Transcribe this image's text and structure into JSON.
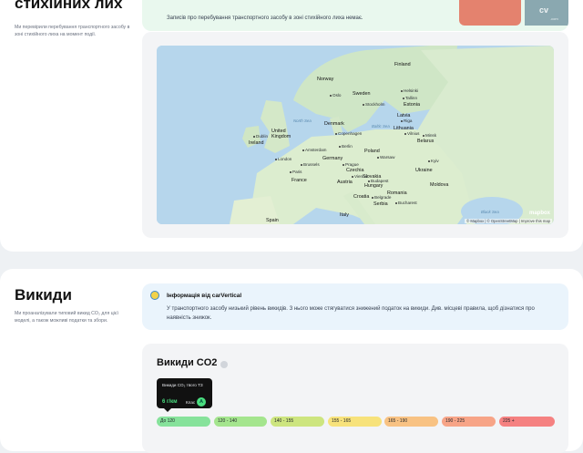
{
  "disasters": {
    "title": "стихійних лих",
    "description": "Ми перевірили перебування транспортного засобу в зоні стихійного лиха на момент події.",
    "notice": "Записів про перебування транспортного засобу в зоні стихійного лиха немає.",
    "thumbnail_logo": "cv",
    "thumbnail_small": ".com",
    "map": {
      "attribution": "© Mapbox | © OpenStreetMap | Improve this map",
      "logo": "mapbox",
      "countries": [
        "Finland",
        "Norway",
        "Sweden",
        "Estonia",
        "Latvia",
        "Lithuania",
        "Belarus",
        "Denmark",
        "United Kingdom",
        "Ireland",
        "Poland",
        "Germany",
        "Czechia",
        "Ukraine",
        "France",
        "Austria",
        "Hungary",
        "Croatia",
        "Romania",
        "Serbia",
        "Italy",
        "Spain",
        "Slovakia",
        "Moldova"
      ],
      "cities": [
        "Oslo",
        "Stockholm",
        "Helsinki",
        "Tallinn",
        "Riga",
        "Vilnius",
        "Minsk",
        "Copenhagen",
        "Dublin",
        "London",
        "Amsterdam",
        "Brussels",
        "Berlin",
        "Warsaw",
        "Prague",
        "Vienna",
        "Kyiv",
        "Paris",
        "Budapest",
        "Bucharest",
        "Belgrade"
      ],
      "seas": [
        "North Sea",
        "Baltic Sea",
        "Black Sea"
      ]
    }
  },
  "emissions": {
    "title": "Викиди",
    "description": "Ми проаналізували типовий викид CO₂ для цієї моделі, а також можливі податки та збори.",
    "info_title": "Інформація від carVertical",
    "info_body": "У транспортного засобу низький рівень викидів. З нього може стягуватися знижений податок на викиди. Див. місцеві правила, щоб дізнатися про наявність знижок.",
    "co2_title": "Викиди CO2",
    "tooltip": {
      "label": "Викиди CO₂ твого ТЗ",
      "value": "6 г/км",
      "class_label": "Клас",
      "class_value": "A"
    },
    "scale": [
      {
        "label": "До 120",
        "color": "#86e29b"
      },
      {
        "label": "120 - 140",
        "color": "#a4e58e"
      },
      {
        "label": "140 - 155",
        "color": "#cde57f"
      },
      {
        "label": "155 - 165",
        "color": "#f7e27b"
      },
      {
        "label": "165 - 190",
        "color": "#f8c283"
      },
      {
        "label": "190 - 225",
        "color": "#f7a487"
      },
      {
        "label": "225 +",
        "color": "#f58181"
      }
    ]
  }
}
